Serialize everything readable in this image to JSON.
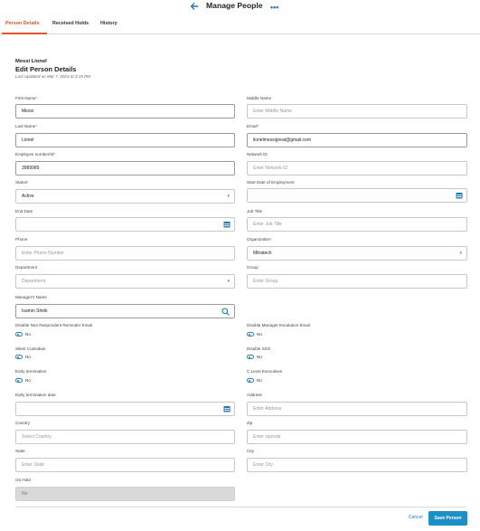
{
  "header": {
    "title": "Manage People",
    "back_icon": "arrow-left-icon",
    "more_icon": "more-horizontal-icon",
    "more_glyph": "•••"
  },
  "tabs": [
    {
      "label": "Person Details",
      "active": true
    },
    {
      "label": "Received Holds",
      "active": false
    },
    {
      "label": "History",
      "active": false
    }
  ],
  "person": {
    "name": "Messi Lionel",
    "section_title": "Edit Person Details",
    "last_updated": "Last Updated on Mar 7, 2024 at 3:15 PM"
  },
  "form": {
    "first_name": {
      "label": "First Name",
      "value": "Messi"
    },
    "middle_name": {
      "label": "Middle Name",
      "placeholder": "Enter Middle Name"
    },
    "last_name": {
      "label": "Last Name",
      "value": "Lionel"
    },
    "email": {
      "label": "Email",
      "value": "lionelmessigreat@gmail.com"
    },
    "employee_number": {
      "label": "Employee number/Id",
      "value": "3989989"
    },
    "network_id": {
      "label": "Network ID",
      "placeholder": "Enter Network ID"
    },
    "status": {
      "label": "Status",
      "value": "Active"
    },
    "start_date": {
      "label": "Start Date of Employment",
      "value": ""
    },
    "end_date": {
      "label": "End Date",
      "value": ""
    },
    "job_title": {
      "label": "Job Title",
      "placeholder": "Enter Job Title"
    },
    "phone": {
      "label": "Phone",
      "placeholder": "Enter Phone Number"
    },
    "organization": {
      "label": "Organization",
      "value": "Mitratech"
    },
    "department": {
      "label": "Department",
      "placeholder": "Department"
    },
    "group": {
      "label": "Group",
      "placeholder": "Enter Group"
    },
    "manager_name": {
      "label": "Manager's Name",
      "value": "Isamin Sheik"
    },
    "disable_non_respondent": {
      "label": "Disable Non Respondent Reminder Email",
      "value": "No"
    },
    "disable_manager_escalation": {
      "label": "Disable Manager Escalation Email",
      "value": "No"
    },
    "silent_custodian": {
      "label": "Silent Custodian",
      "value": "No"
    },
    "disable_sso": {
      "label": "Disable SSO",
      "value": "No"
    },
    "early_termination": {
      "label": "Early termination",
      "value": "No"
    },
    "c_level_executives": {
      "label": "C Level Executives",
      "value": "No"
    },
    "early_termination_date": {
      "label": "Early termination date",
      "value": ""
    },
    "address": {
      "label": "Address",
      "placeholder": "Enter Address"
    },
    "country": {
      "label": "Country",
      "placeholder": "Select Country"
    },
    "zip": {
      "label": "Zip",
      "placeholder": "Enter zipcode"
    },
    "state": {
      "label": "State",
      "placeholder": "Enter State"
    },
    "city": {
      "label": "City",
      "placeholder": "Enter City"
    },
    "on_hold": {
      "label": "On Hold",
      "value": "No"
    }
  },
  "footer": {
    "cancel_label": "Cancel",
    "save_label": "Save Person"
  },
  "colors": {
    "accent": "#e0562a",
    "primary": "#1b90c6",
    "required": "#d9534f"
  }
}
